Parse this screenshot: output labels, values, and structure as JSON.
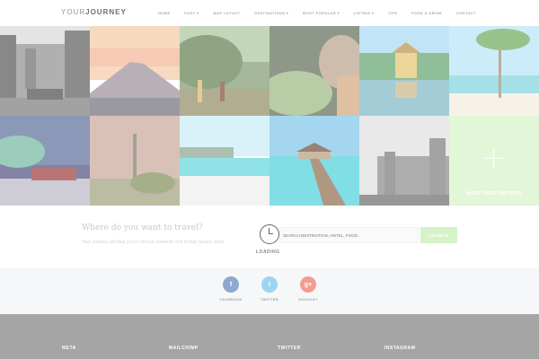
{
  "header": {
    "logo_light": "YOUR",
    "logo_bold": "JOURNEY",
    "nav": [
      "HOME",
      "POST",
      "MAP LAYOUT",
      "DESTINATIONS",
      "MOST POPULAR",
      "LISTING",
      "TIPS",
      "FOOD & DRINK",
      "CONTACT"
    ]
  },
  "grid": {
    "more_label": "MORE DESTINATIONS"
  },
  "travel": {
    "title": "Where do you want to travel?",
    "subtitle": "Your Journey will lead you to famous domestic and foreign beauty spots",
    "loading": "LOADING",
    "search_placeholder": "SEARCH DESTINATION, HOTEL, FOOD...",
    "search_button": "SEARCH"
  },
  "social": {
    "facebook": "FACEBOOK",
    "twitter": "TWITTER",
    "google": "GOOGLE+",
    "facebook_glyph": "f",
    "twitter_glyph": "t",
    "google_glyph": "g+"
  },
  "footer": {
    "col1": "META",
    "col2": "MAILCHIMP",
    "col3": "TWITTER",
    "col4": "INSTAGRAM"
  },
  "colors": {
    "accent_green": "#d6f2c8",
    "facebook": "#8fa8cf",
    "twitter": "#9bd6ef",
    "google": "#f19c90",
    "footer": "#a5a5a5"
  },
  "icons": {
    "clock": "clock-icon",
    "plus": "plus-icon"
  }
}
